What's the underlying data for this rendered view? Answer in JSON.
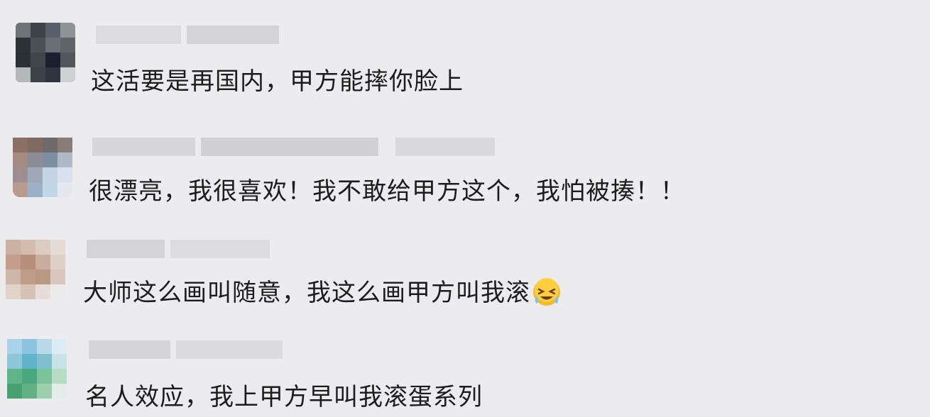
{
  "comments": [
    {
      "text": "这活要是再国内，甲方能摔你脸上",
      "avatar": [
        "#6f7478",
        "#3d4346",
        "#57606a",
        "#8e9397",
        "#2c3236",
        "#4a5257",
        "#687075",
        "#5e6468",
        "#2a3035",
        "#3f474c",
        "#1b2030",
        "#50585c",
        "#b5b9bc",
        "#3a4246",
        "#2d3440",
        "#cfd2d4"
      ],
      "name_blocks": [
        "#dcdce0",
        "#d3d3d8",
        "#dedee2"
      ]
    },
    {
      "text": "很漂亮，我很喜欢！我不敢给甲方这个，我怕被揍！！",
      "avatar": [
        "#8b6f62",
        "#7d6a60",
        "#6e6a6c",
        "#8a7d78",
        "#a58b80",
        "#8c8c96",
        "#7e8fa4",
        "#b0b8c8",
        "#9c8e92",
        "#a0a8b8",
        "#c6d4e4",
        "#d7e2ee",
        "#b89a8e",
        "#9ab0c8",
        "#c2d6ea",
        "#e4e8ee"
      ],
      "name_blocks": [
        "#d6d6da",
        "#cfcfd4",
        "#d9d9dd"
      ]
    },
    {
      "text": "大师这么画叫随意，我这么画甲方叫我滚",
      "emoji": "grinning-squinting-sweat-emoji",
      "avatar": [
        "#cbb2a4",
        "#d2bcae",
        "#dccbc0",
        "#e6dbd4",
        "#c49e8a",
        "#b88f7a",
        "#c9ae9f",
        "#dfd0c6",
        "#cfb7a8",
        "#bf9d89",
        "#b99884",
        "#d8c7bc",
        "#e0d3ca",
        "#d4c2b6",
        "#e7ddd6",
        "#ecebeb"
      ],
      "name_blocks": [
        "#d4d4d8",
        "#dcdcdf",
        "#d6dcd8"
      ]
    },
    {
      "text": "名人效应，我上甲方早叫我滚蛋系列",
      "avatar": [
        "#a9d3ea",
        "#8cc3e2",
        "#b9dbe9",
        "#dcecf2",
        "#8ec7d8",
        "#62b4c8",
        "#7fc0cc",
        "#c7e3e6",
        "#5fb48a",
        "#4aa67c",
        "#79c29a",
        "#b7dcc4",
        "#48a070",
        "#62b083",
        "#9ccfae",
        "#e3ece6"
      ],
      "name_blocks": [
        "#d5d5d9",
        "#dbdbde",
        "#d8d8dc"
      ]
    }
  ]
}
